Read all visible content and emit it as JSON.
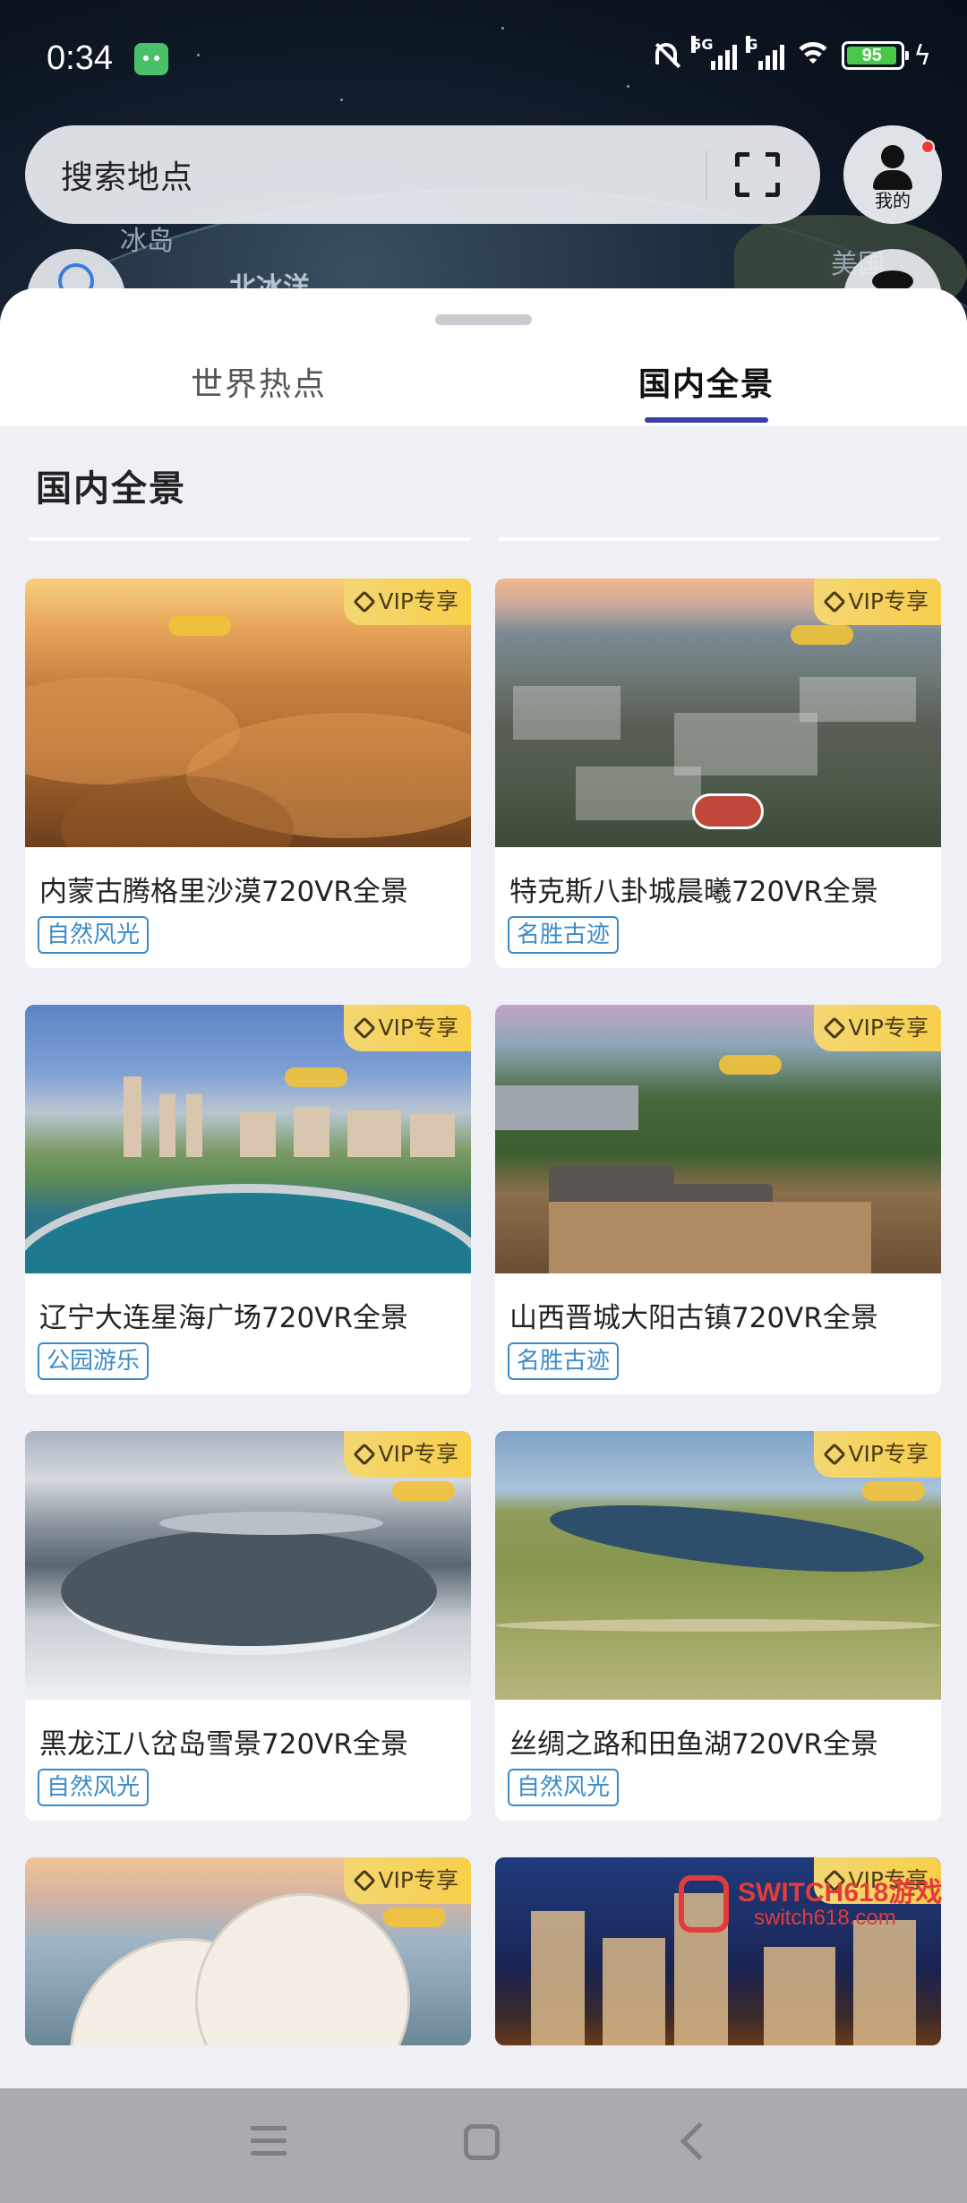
{
  "status": {
    "time": "0:34",
    "network_1": "5G",
    "network_2": "G",
    "battery": "95"
  },
  "map": {
    "labels": [
      "冰岛",
      "北冰洋",
      "美国"
    ]
  },
  "search": {
    "placeholder": "搜索地点"
  },
  "profile": {
    "label": "我的"
  },
  "tabs": [
    {
      "label": "世界热点",
      "active": false
    },
    {
      "label": "国内全景",
      "active": true
    }
  ],
  "section": {
    "title": "国内全景"
  },
  "vip_label": "VIP专享",
  "cards": [
    {
      "title": "内蒙古腾格里沙漠720VR全景",
      "tag": "自然风光"
    },
    {
      "title": "特克斯八卦城晨曦720VR全景",
      "tag": "名胜古迹"
    },
    {
      "title": "辽宁大连星海广场720VR全景",
      "tag": "公园游乐"
    },
    {
      "title": "山西晋城大阳古镇720VR全景",
      "tag": "名胜古迹"
    },
    {
      "title": "黑龙江八岔岛雪景720VR全景",
      "tag": "自然风光"
    },
    {
      "title": "丝绸之路和田鱼湖720VR全景",
      "tag": "自然风光"
    },
    {
      "title": "",
      "tag": ""
    },
    {
      "title": "",
      "tag": ""
    }
  ],
  "watermark": {
    "line1": "SWITCH618游戏",
    "line2": "switch618.com"
  },
  "colors": {
    "accent": "#3b3eac",
    "tag": "#3b8bc9",
    "vip": "#f7cf4c"
  }
}
